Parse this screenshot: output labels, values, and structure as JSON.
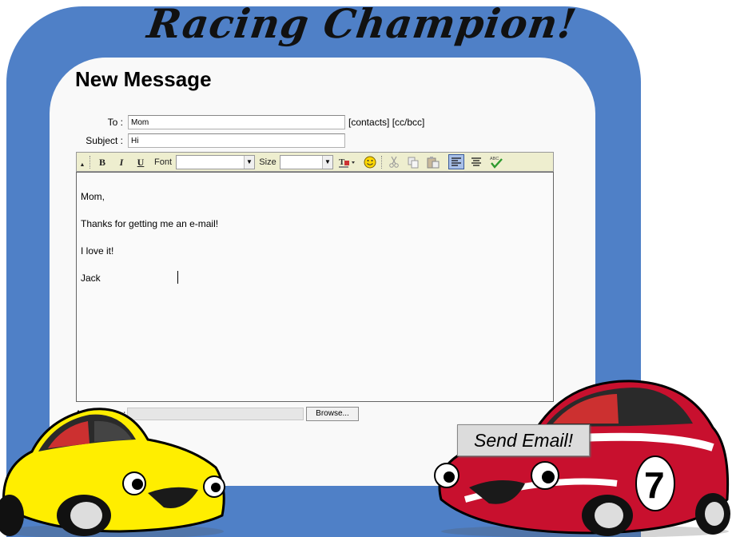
{
  "banner": {
    "title": "Racing Champion!"
  },
  "compose": {
    "heading": "New Message",
    "to_label": "To :",
    "to_value": "Mom",
    "subject_label": "Subject :",
    "subject_value": "Hi",
    "links": "[contacts] [cc/bcc]"
  },
  "toolbar": {
    "bold": "B",
    "italic": "I",
    "underline": "U",
    "font_label": "Font",
    "font_value": "",
    "size_label": "Size",
    "size_value": "",
    "icons": [
      "text-color-icon",
      "smiley-icon",
      "cut-icon",
      "copy-icon",
      "paste-icon",
      "align-left-icon",
      "align-center-icon",
      "spellcheck-icon"
    ]
  },
  "body": {
    "lines": [
      "Mom,",
      "Thanks for getting me an e-mail!",
      "I love it!",
      "Jack"
    ]
  },
  "attach": {
    "label": "Attach File :",
    "browse_label": "Browse..."
  },
  "send": {
    "label": "Send Email!"
  },
  "colors": {
    "frame": "#4f80c7",
    "panel": "#f9f9f9",
    "toolbar": "#eeeecf",
    "yellow_car": "#ffee00",
    "red_car": "#c8102e"
  }
}
